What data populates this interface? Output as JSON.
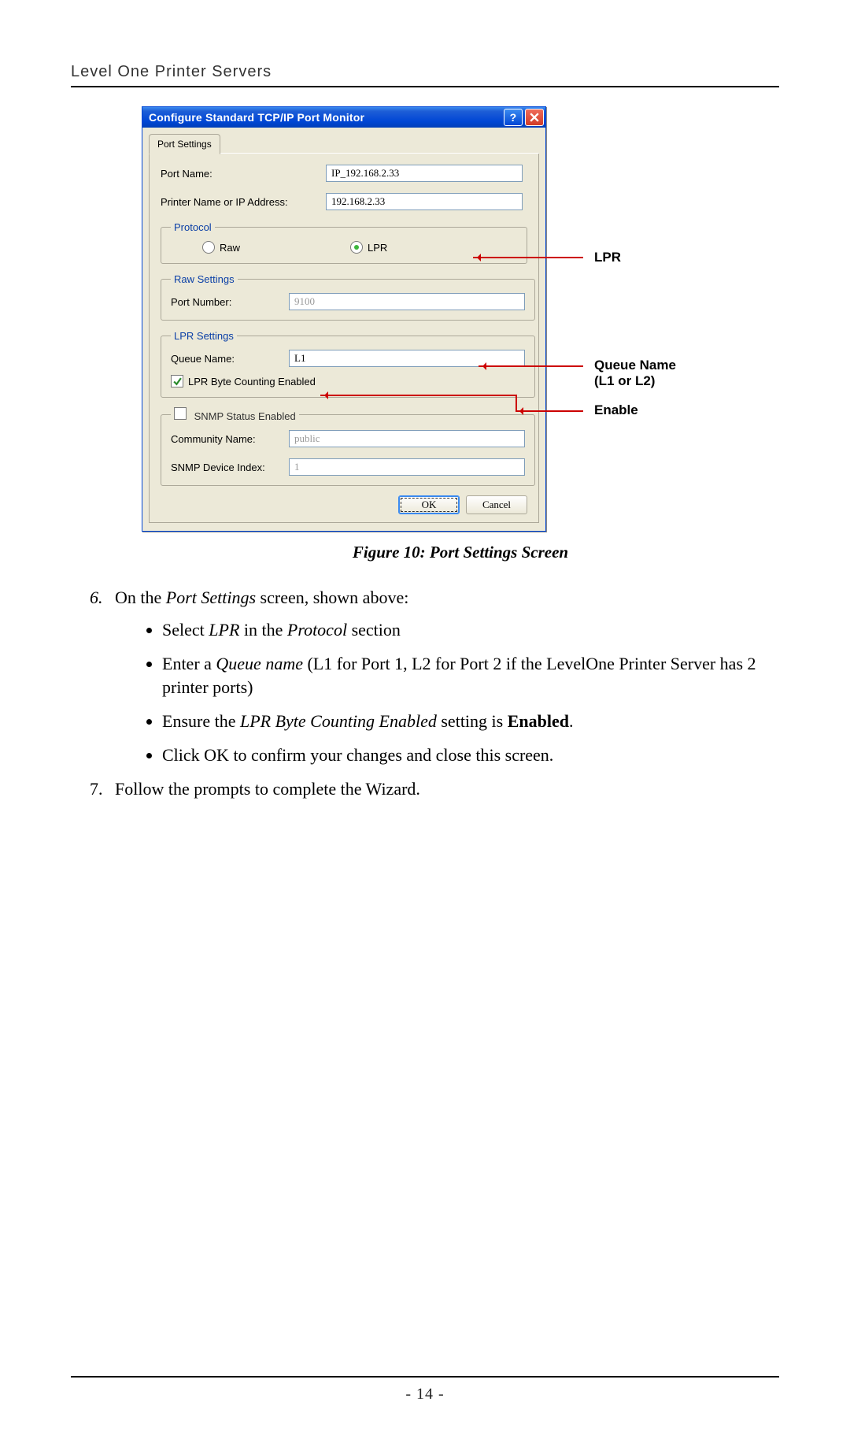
{
  "doc": {
    "header": "Level One Printer Servers",
    "page_number": "- 14 -"
  },
  "figure": {
    "caption": "Figure 10: Port Settings Screen",
    "callouts": {
      "lpr": "LPR",
      "queue_l1": "Queue Name",
      "queue_l2": "(L1 or L2)",
      "enable": "Enable"
    }
  },
  "dialog": {
    "title": "Configure Standard TCP/IP Port Monitor",
    "help_glyph": "?",
    "tab": "Port Settings",
    "port_name_label": "Port Name:",
    "port_name_value": "IP_192.168.2.33",
    "printer_addr_label": "Printer Name or IP Address:",
    "printer_addr_value": "192.168.2.33",
    "protocol_legend": "Protocol",
    "protocol_raw": "Raw",
    "protocol_lpr": "LPR",
    "raw_legend": "Raw Settings",
    "raw_port_label": "Port Number:",
    "raw_port_value": "9100",
    "lpr_legend": "LPR Settings",
    "lpr_queue_label": "Queue Name:",
    "lpr_queue_value": "L1",
    "lpr_byte_label": "LPR Byte Counting Enabled",
    "snmp_legend": "SNMP Status Enabled",
    "snmp_comm_label": "Community Name:",
    "snmp_comm_value": "public",
    "snmp_index_label": "SNMP Device Index:",
    "snmp_index_value": "1",
    "ok": "OK",
    "cancel": "Cancel"
  },
  "text": {
    "step6_lead": "On the ",
    "step6_em": "Port Settings",
    "step6_tail": " screen, shown above:",
    "b1_a": "Select ",
    "b1_em": "LPR",
    "b1_b": " in the ",
    "b1_em2": "Protocol",
    "b1_c": " section",
    "b2_a": "Enter a ",
    "b2_em": "Queue name",
    "b2_b": " (L1 for Port 1, L2 for Port 2 if the LevelOne Printer Server has 2 printer ports)",
    "b3_a": "Ensure the ",
    "b3_em": "LPR Byte Counting Enabled",
    "b3_b": " setting is ",
    "b3_bold": "Enabled",
    "b3_c": ".",
    "b4": "Click OK to confirm your changes and close this screen.",
    "step7": "Follow the prompts to complete the Wizard."
  }
}
